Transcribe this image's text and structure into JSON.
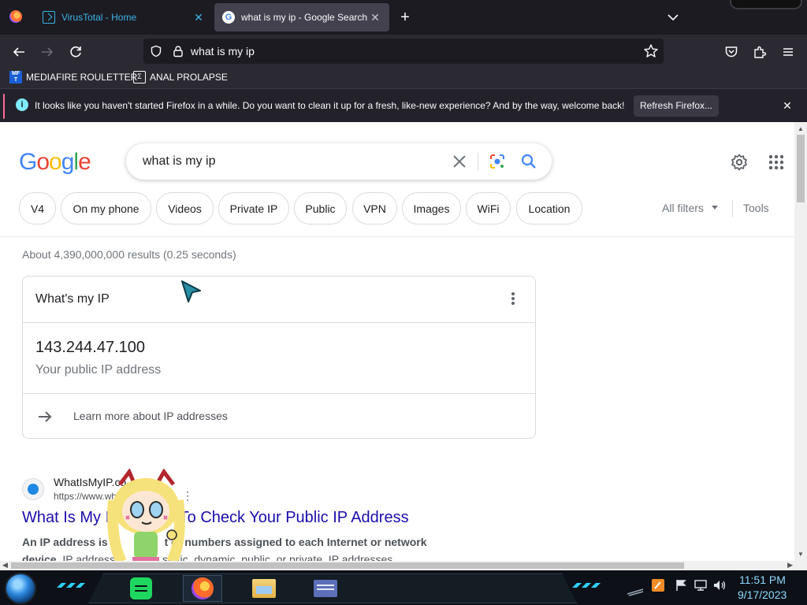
{
  "tabs": [
    {
      "title": "VirusTotal - Home",
      "active": false
    },
    {
      "title": "what is my ip - Google Search",
      "active": true
    }
  ],
  "urlbar": {
    "value": "what is my ip"
  },
  "bookmarks": [
    {
      "label": "MEDIAFIRE ROULETTER",
      "icon_text": "MF\nT"
    },
    {
      "label": "ANAL PROLAPSE",
      "icon_text": "Σ"
    }
  ],
  "notification": {
    "text": "It looks like you haven't started Firefox in a while. Do you want to clean it up for a fresh, like-new experience? And by the way, welcome back!",
    "button": "Refresh Firefox..."
  },
  "google": {
    "logo_letters": [
      "G",
      "o",
      "o",
      "g",
      "l",
      "e"
    ],
    "query": "what is my ip",
    "chips": [
      "V4",
      "On my phone",
      "Videos",
      "Private IP",
      "Public",
      "VPN",
      "Images",
      "WiFi",
      "Location"
    ],
    "all_filters": "All filters",
    "tools": "Tools",
    "result_stats": "About 4,390,000,000 results (0.25 seconds)",
    "ip_card": {
      "title": "What's my IP",
      "ip": "143.244.47.100",
      "caption": "Your public IP address",
      "learn_more": "Learn more about IP addresses"
    },
    "result": {
      "site": "WhatIsMyIP.co",
      "url": "https://www.wh",
      "title": "What Is My IP — Way To Check Your Public IP Address",
      "snippet_bold": "An IP address is",
      "snippet_mid": "t of numbers assigned to each Internet or network",
      "snippet_line2_bold": "device",
      "snippet_line2": ". IP address",
      "snippet_line2_tail": "static, dynamic, public, or private. IP addresses ..."
    }
  },
  "taskbar": {
    "time": "11:51 PM",
    "date": "9/17/2023"
  },
  "colors": {
    "google_blue": "#4285f4",
    "link_blue": "#1a0dab",
    "firefox_dark": "#1c1b22",
    "clock_cyan": "#8fd9ff"
  }
}
